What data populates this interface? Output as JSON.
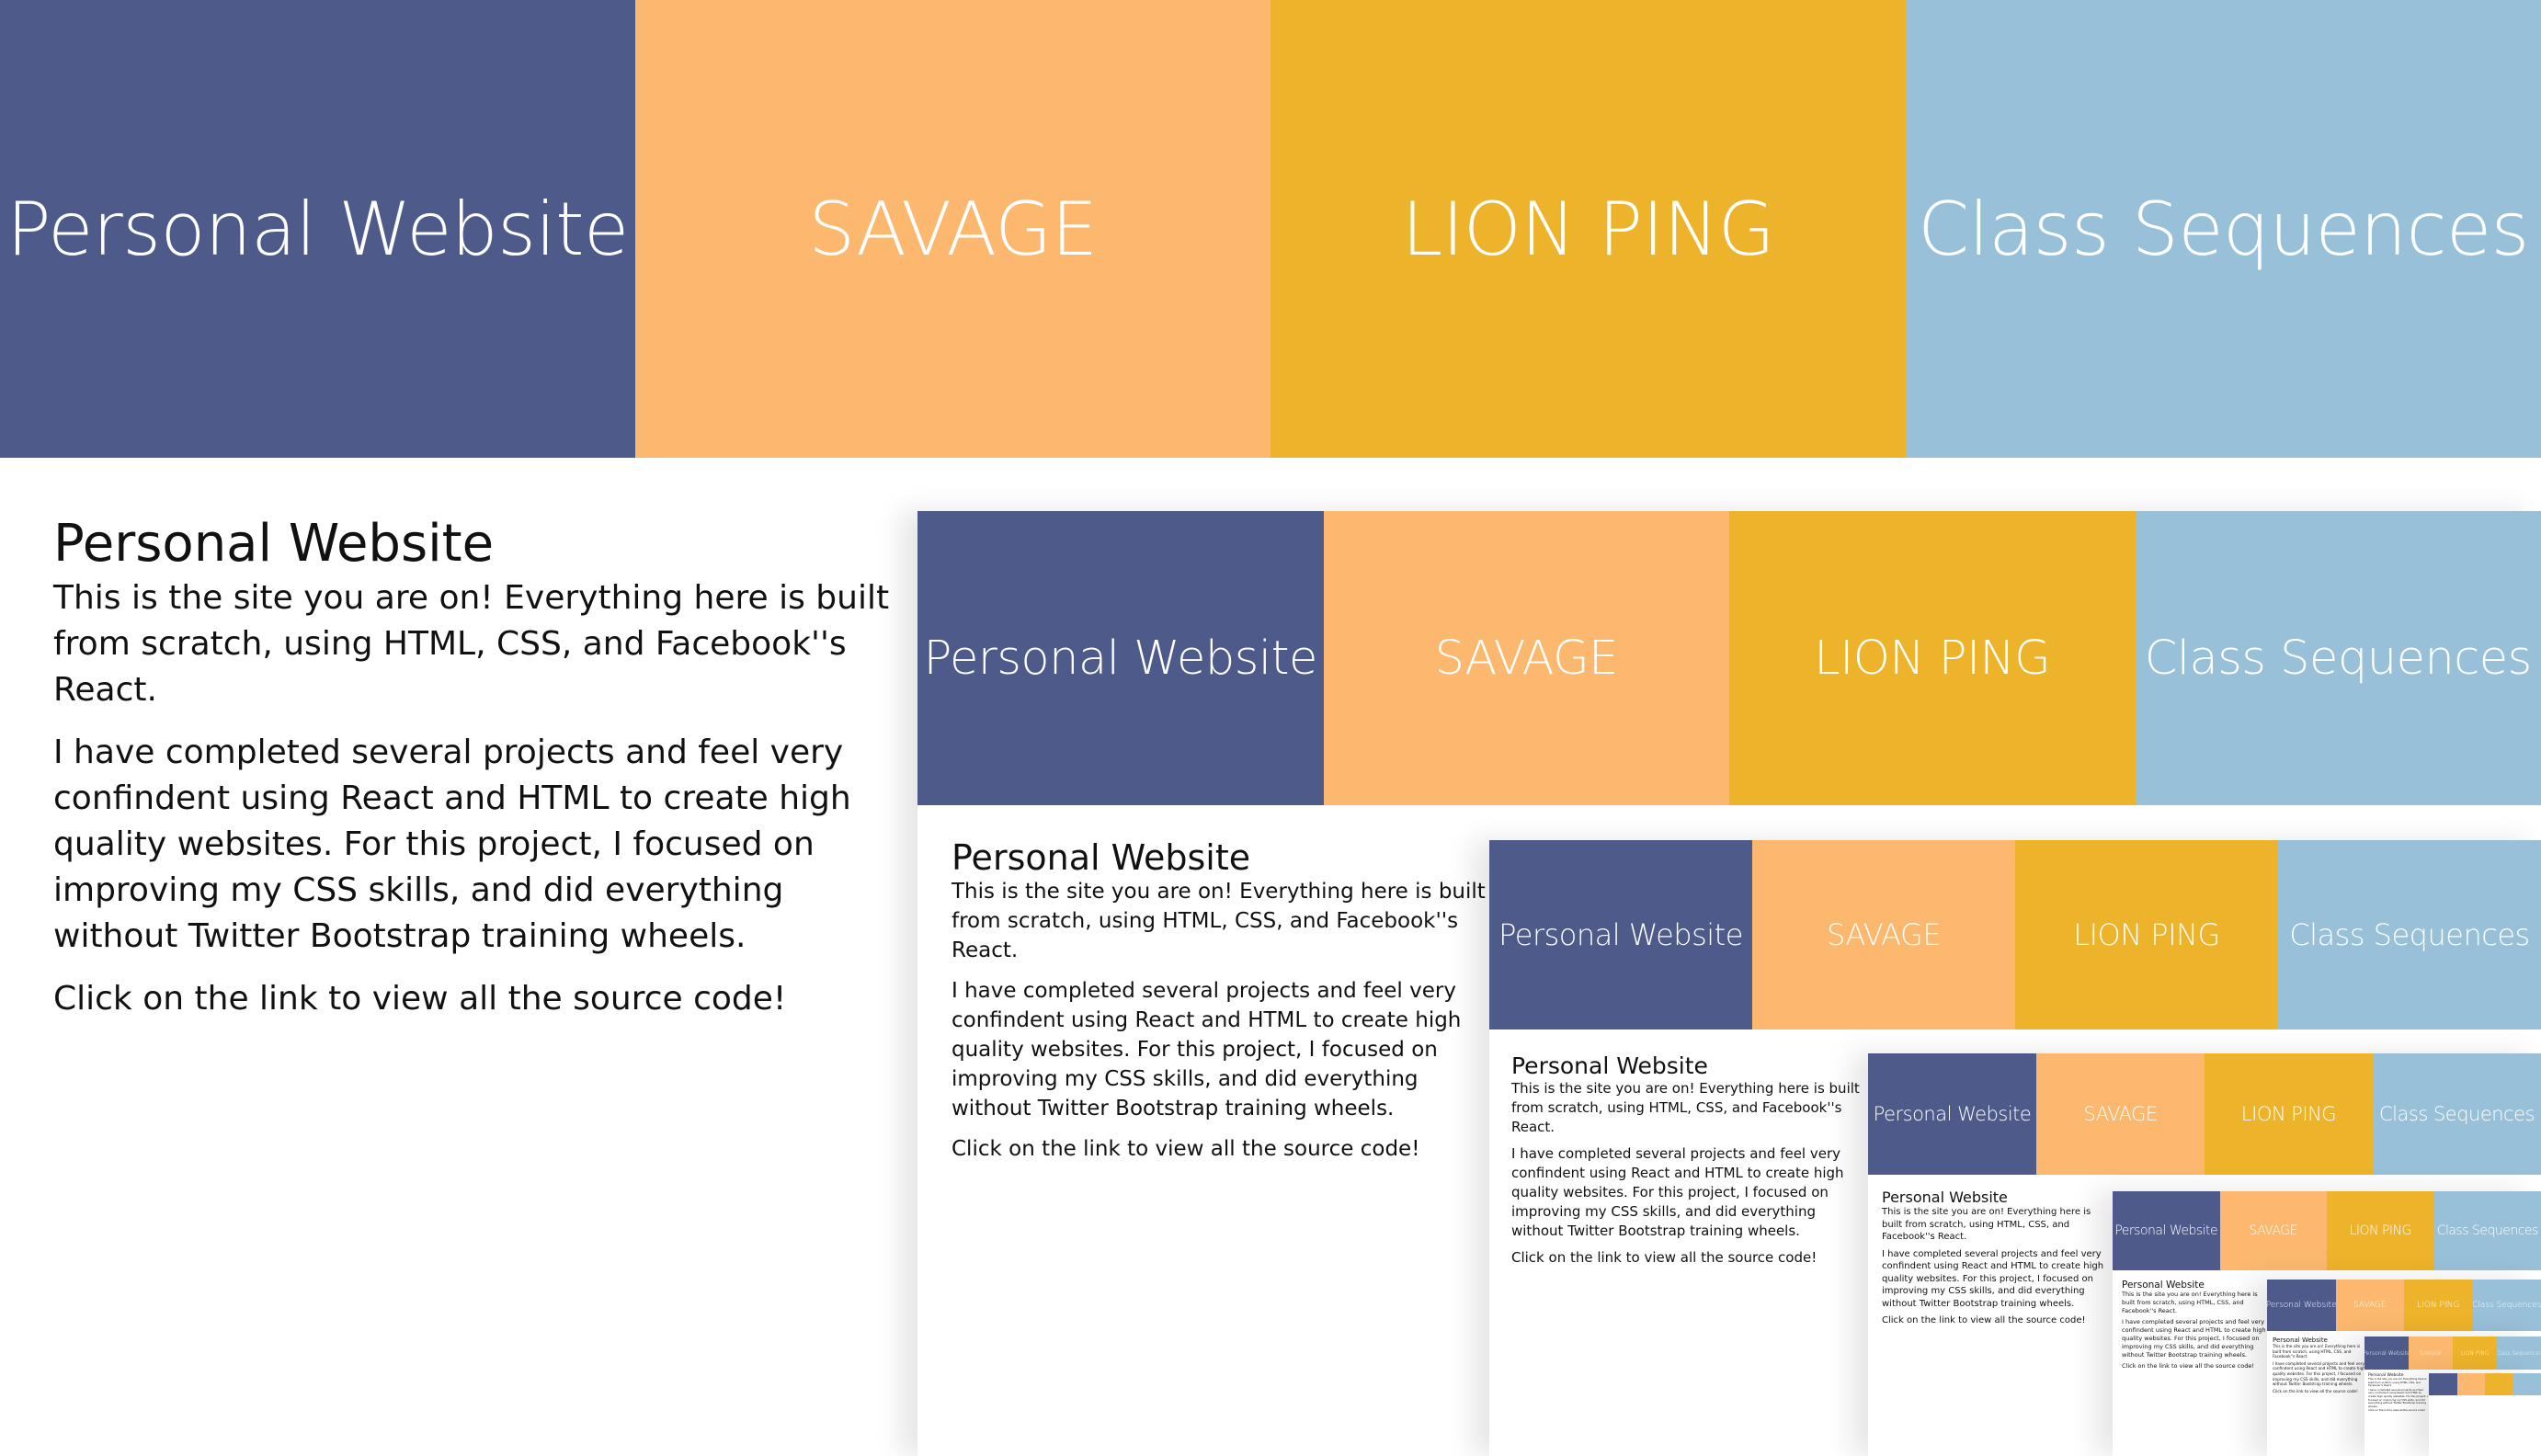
{
  "nav": {
    "tiles": [
      "Personal Website",
      "SAVAGE",
      "LION PING",
      "Class Sequences"
    ]
  },
  "project": {
    "title": "Personal Website",
    "paragraphs": [
      "This is the site you are on! Everything here is built from scratch, using HTML, CSS, and Facebook''s React.",
      "I have completed several projects and feel very confindent using React and HTML to create high quality websites. For this project, I focused on improving my CSS skills, and did everything without Twitter Bootstrap training wheels.",
      "Click on the link to view all the source code!"
    ]
  },
  "colors": {
    "personal_website": "#4d5a8a",
    "savage": "#fbb86e",
    "lion_ping": "#edb32b",
    "class_sequences": "#98c0d8"
  }
}
